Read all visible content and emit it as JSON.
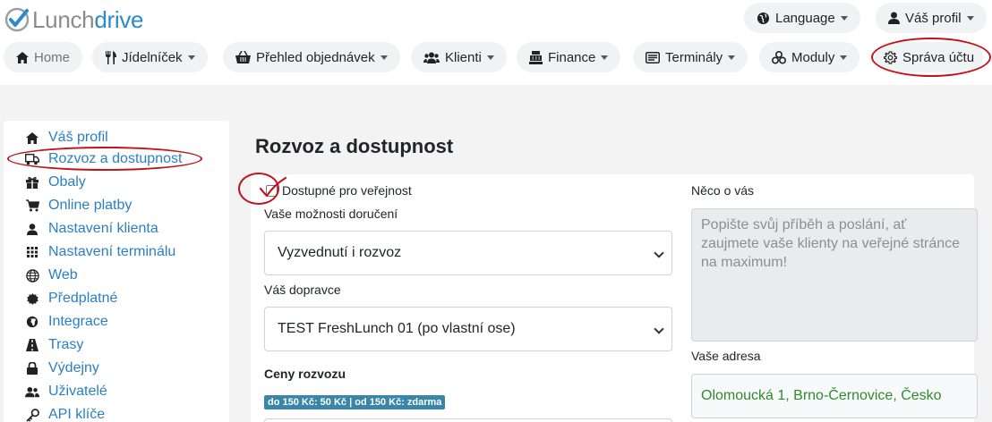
{
  "app": {
    "logo_part1": "Lunch",
    "logo_part2": "drive",
    "brand_blue": "#2b8ac9",
    "link_blue": "#2b7fc4"
  },
  "header": {
    "language": "Language",
    "profile": "Váš profil"
  },
  "nav": {
    "home": "Home",
    "menu": "Jídelníček",
    "orders": "Přehled objednávek",
    "clients": "Klienti",
    "finance": "Finance",
    "terminals": "Terminály",
    "modules": "Moduly",
    "account": "Správa účtu"
  },
  "sidebar": {
    "items": [
      {
        "label": "Váš profil",
        "icon": "home-icon"
      },
      {
        "label": "Rozvoz a dostupnost",
        "icon": "truck-icon"
      },
      {
        "label": "Obaly",
        "icon": "gift-icon"
      },
      {
        "label": "Online platby",
        "icon": "cart-icon"
      },
      {
        "label": "Nastavení klienta",
        "icon": "user-icon"
      },
      {
        "label": "Nastavení terminálu",
        "icon": "grid-icon"
      },
      {
        "label": "Web",
        "icon": "globe-icon"
      },
      {
        "label": "Předplatné",
        "icon": "certificate-icon"
      },
      {
        "label": "Integrace",
        "icon": "globe-africa-icon"
      },
      {
        "label": "Trasy",
        "icon": "road-icon"
      },
      {
        "label": "Výdejny",
        "icon": "lock-icon"
      },
      {
        "label": "Uživatelé",
        "icon": "users-icon"
      },
      {
        "label": "API klíče",
        "icon": "key-icon"
      }
    ]
  },
  "main": {
    "title": "Rozvoz a dostupnost",
    "public_label": "Dostupné pro veřejnost",
    "public_checked": false,
    "delivery_label": "Vaše možnosti doručení",
    "delivery_value": "Vyzvednutí i rozvoz",
    "carrier_label": "Váš dopravce",
    "carrier_value": "TEST FreshLunch 01 (po vlastní ose)",
    "prices_label": "Ceny rozvozu",
    "price_badge": "do 150 Kč: 50 Kč | od 150 Kč: zdarma",
    "about_label": "Něco o vás",
    "about_placeholder": "Popište svůj příběh a poslání, ať zaujmete vaše klienty na veřejné stránce na maximum!",
    "address_label": "Vaše adresa",
    "address_value": "Olomoucká 1, Brno-Černovice, Česko"
  },
  "annotations": {
    "color": "#c0141c"
  }
}
